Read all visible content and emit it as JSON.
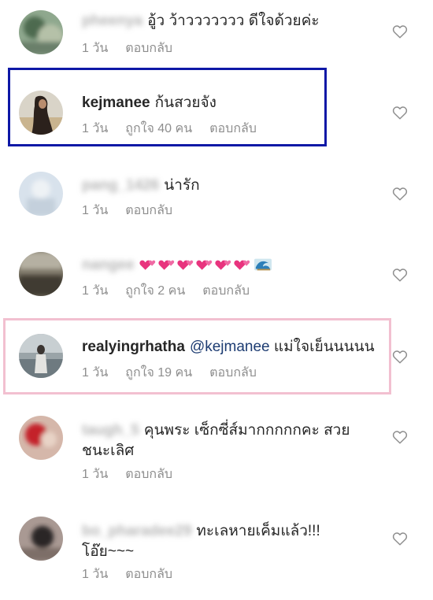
{
  "comments": [
    {
      "username": "pheenya",
      "username_blurred": true,
      "text": "อู้ว ว้าววววววว ดีใจด้วยค่ะ",
      "time": "1 วัน",
      "reply": "ตอบกลับ"
    },
    {
      "username": "kejmanee",
      "username_blurred": false,
      "text": "ก้นสวยจัง",
      "time": "1 วัน",
      "likes": "ถูกใจ 40 คน",
      "reply": "ตอบกลับ",
      "highlight": "blue"
    },
    {
      "username": "pang_1426",
      "username_blurred": true,
      "text": "น่ารัก",
      "time": "1 วัน",
      "reply": "ตอบกลับ"
    },
    {
      "username": "nangee",
      "username_blurred": true,
      "emoji": [
        "heart",
        "heart",
        "heart",
        "heart",
        "heart",
        "heart",
        "wave"
      ],
      "time": "1 วัน",
      "likes": "ถูกใจ 2 คน",
      "reply": "ตอบกลับ"
    },
    {
      "username": "realyingrhatha",
      "username_blurred": false,
      "mention": "@kejmanee",
      "text": "แม่ใจเย็นนนนน",
      "time": "1 วัน",
      "likes": "ถูกใจ 19 คน",
      "reply": "ตอบกลับ",
      "highlight": "pink"
    },
    {
      "username": "taugh_5",
      "username_blurred": true,
      "text": "คุนพระ เซ็กซี่ส์มากกกกกคะ สวย",
      "text_line2": "ชนะเลิศ",
      "time": "1 วัน",
      "reply": "ตอบกลับ"
    },
    {
      "username": "bo_pharadee29",
      "username_blurred": true,
      "text": "ทะเลหายเค็มแล้ว!!!",
      "text_line2": "โอ๊ย~~~",
      "time": "1 วัน",
      "reply": "ตอบกลับ"
    }
  ],
  "colors": {
    "highlight_blue": "#0e18a6",
    "highlight_pink": "#f2c0d0",
    "meta_text": "#8e8e8e",
    "mention": "#1d3c72"
  },
  "icons": {
    "like": "heart-outline-icon",
    "emoji_heart": "two-hearts-emoji",
    "emoji_wave": "wave-emoji"
  }
}
